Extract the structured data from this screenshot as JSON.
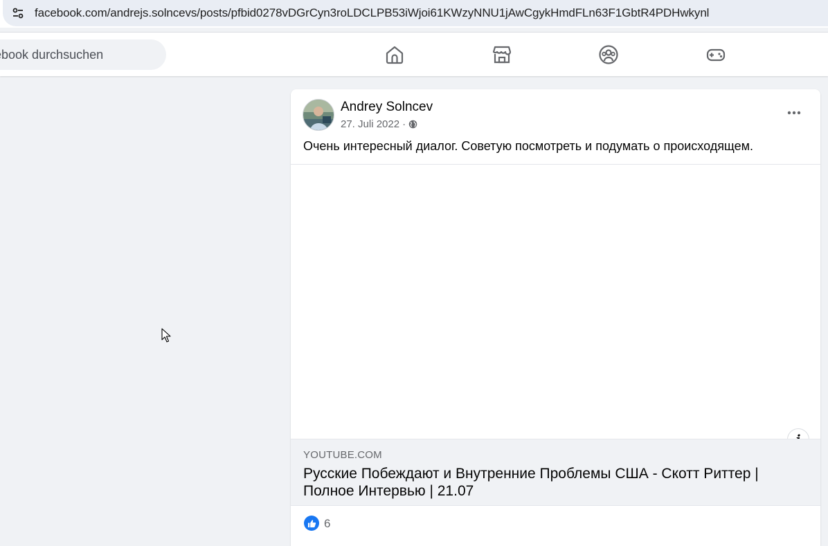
{
  "browser": {
    "url": "facebook.com/andrejs.solncevs/posts/pfbid0278vDGrCyn3roLDCLPB53iWjoi61KWzyNNU1jAwCgykHmdFLn63F1GbtR4PDHwkynl",
    "site_info_icon": "tune-icon"
  },
  "topbar": {
    "search_placeholder": "ebook durchsuchen",
    "nav_icons": [
      "home-icon",
      "marketplace-icon",
      "groups-icon",
      "gaming-icon"
    ]
  },
  "post": {
    "author": "Andrey Solncev",
    "date": "27. Juli 2022",
    "separator": "·",
    "privacy_icon": "globe-icon",
    "text": "Очень интересный диалог. Советую посмотреть и подумать о происходящем.",
    "link": {
      "domain": "YOUTUBE.COM",
      "title": "Русские Побеждают и Внутренние Проблемы США - Скотт Риттер | Полное Интервью | 21.07"
    },
    "info_label": "i",
    "reactions": {
      "like_count": "6"
    }
  },
  "colors": {
    "page_bg": "#f0f2f5",
    "brand_blue": "#1877f2",
    "secondary_text": "#65676b"
  }
}
